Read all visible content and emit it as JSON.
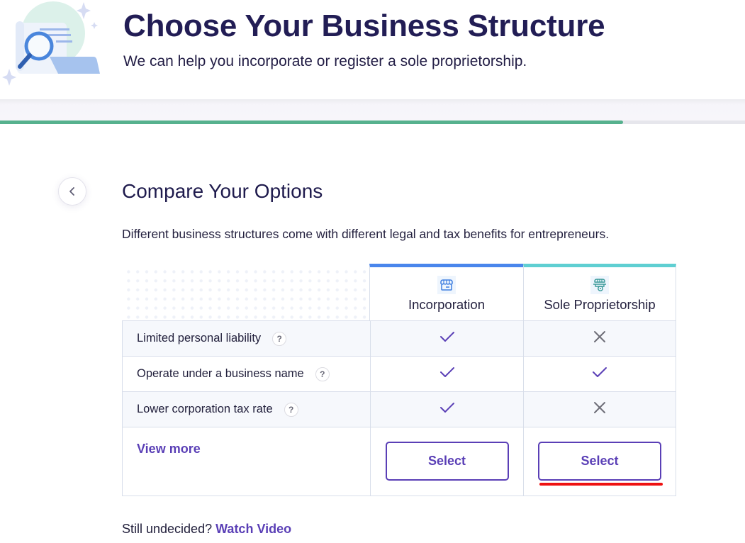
{
  "header": {
    "title": "Choose Your Business Structure",
    "subtitle": "We can help you incorporate or register a sole proprietorship.",
    "illustration": "document-magnifier-illustration"
  },
  "progress": {
    "percent": 83.6,
    "color": "#56b18e"
  },
  "back_button": {
    "icon": "chevron-left-icon"
  },
  "section": {
    "title": "Compare Your Options",
    "description": "Different business structures come with different legal and tax benefits for entrepreneurs."
  },
  "comparison": {
    "columns": [
      {
        "label": "Incorporation",
        "icon": "storefront-icon",
        "accent": "#4a86ec"
      },
      {
        "label": "Sole Proprietorship",
        "icon": "market-cart-icon",
        "accent": "#5fcfd2"
      }
    ],
    "rows": [
      {
        "label": "Limited personal liability",
        "help": "?",
        "values": [
          true,
          false
        ]
      },
      {
        "label": "Operate under a business name",
        "help": "?",
        "values": [
          true,
          true
        ]
      },
      {
        "label": "Lower corporation tax rate",
        "help": "?",
        "values": [
          true,
          false
        ]
      }
    ],
    "view_more": "View more",
    "select_label": "Select"
  },
  "footer": {
    "question": "Still undecided?",
    "link": "Watch Video"
  },
  "colors": {
    "brand_purple": "#5a3fb6",
    "heading": "#221d55",
    "check": "#5a3fb6",
    "cross": "#6e6e78",
    "annotation": "#ee1111"
  }
}
